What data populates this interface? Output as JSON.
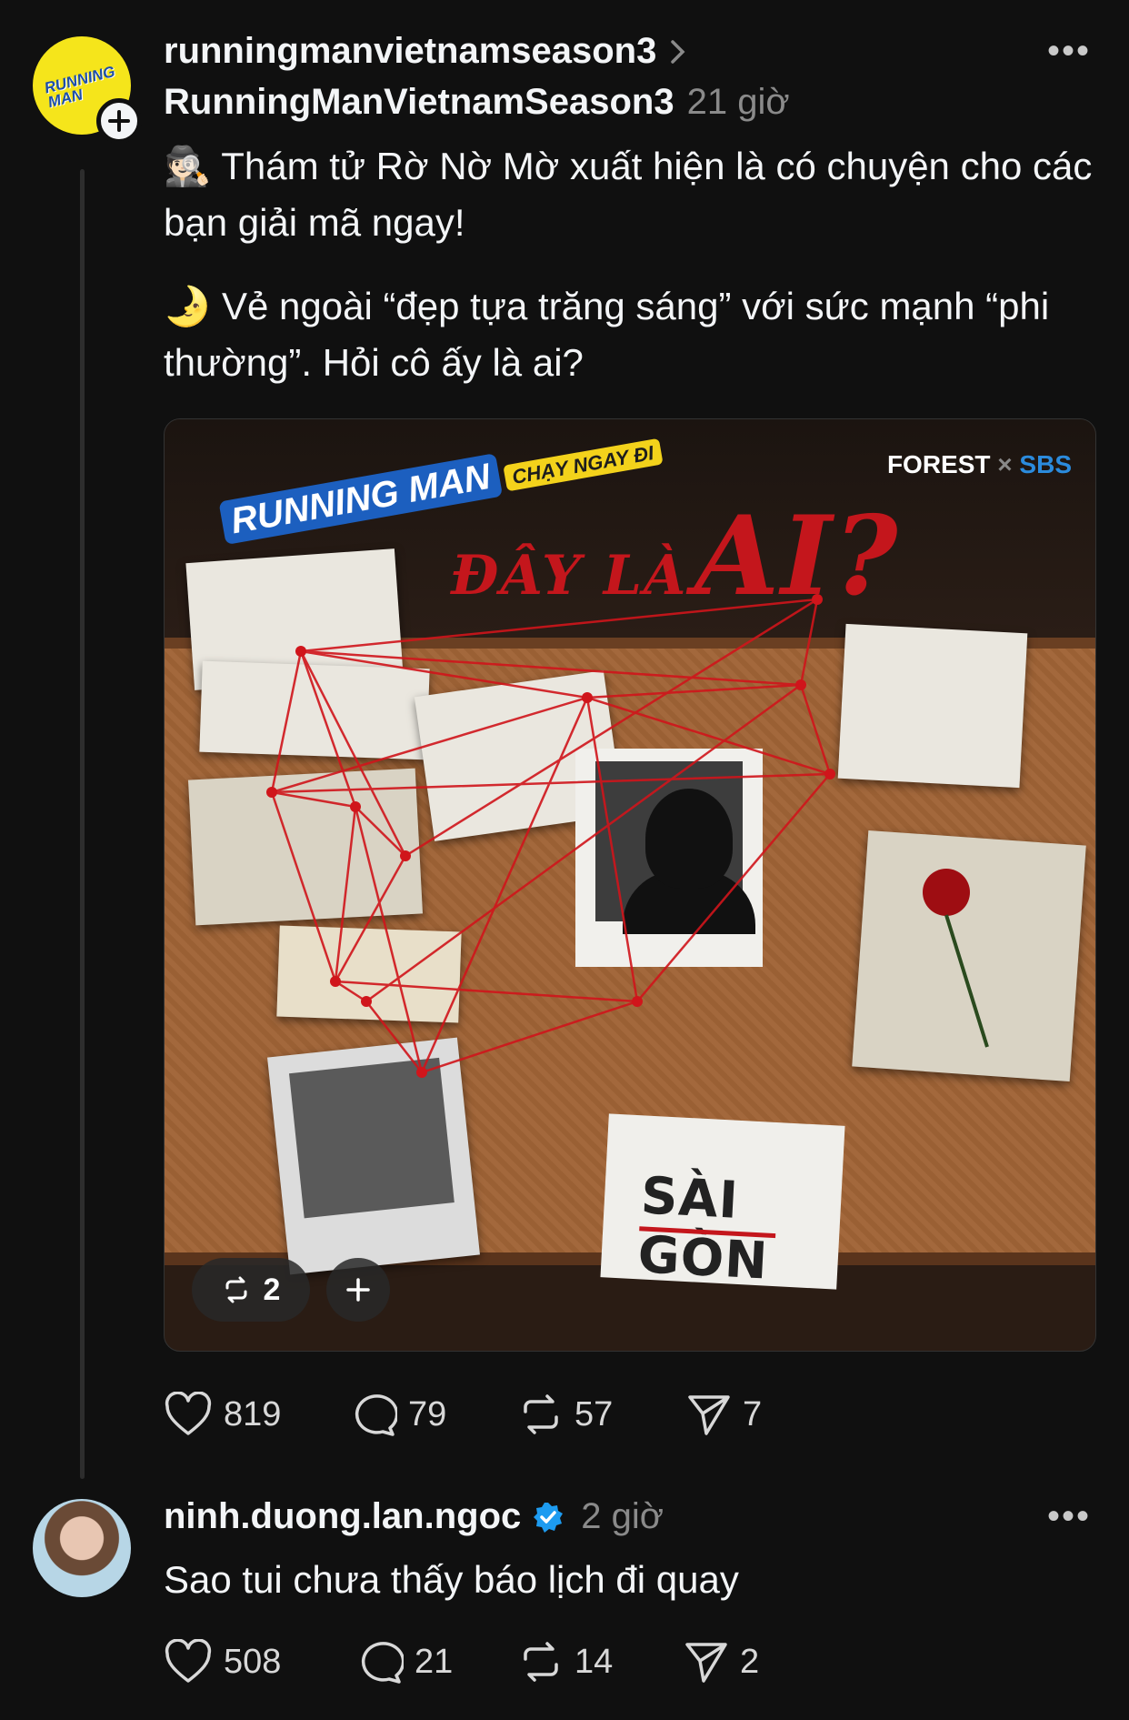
{
  "post": {
    "username": "runningmanvietnamseason3",
    "display_name": "RunningManVietnamSeason3",
    "time": "21 giờ",
    "paragraph1": "🕵🏻 Thám tử Rờ Nờ Mờ xuất hiện là có chuyện cho các bạn giải mã ngay!",
    "paragraph2": "🌛 Vẻ ngoài “đẹp tựa trăng sáng” với sức mạnh “phi thường”. Hỏi cô ấy là ai?",
    "media": {
      "headline_small": "ĐÂY LÀ",
      "headline_big": "AI?",
      "logo_main": "RUNNING MAN",
      "logo_sub": "CHẠY NGAY ĐI",
      "brand_left": "FOREST",
      "brand_sep": "×",
      "brand_right": "SBS",
      "card_text": "SÀI GÒN",
      "repost_count": "2"
    },
    "stats": {
      "likes": "819",
      "comments": "79",
      "reposts": "57",
      "shares": "7"
    }
  },
  "reply": {
    "username": "ninh.duong.lan.ngoc",
    "time": "2 giờ",
    "text": "Sao tui chưa thấy báo lịch đi quay",
    "stats": {
      "likes": "508",
      "comments": "21",
      "reposts": "14",
      "shares": "2"
    }
  },
  "colors": {
    "background": "#101010",
    "verified": "#1d9bf0",
    "accent_red": "#c4161c"
  }
}
